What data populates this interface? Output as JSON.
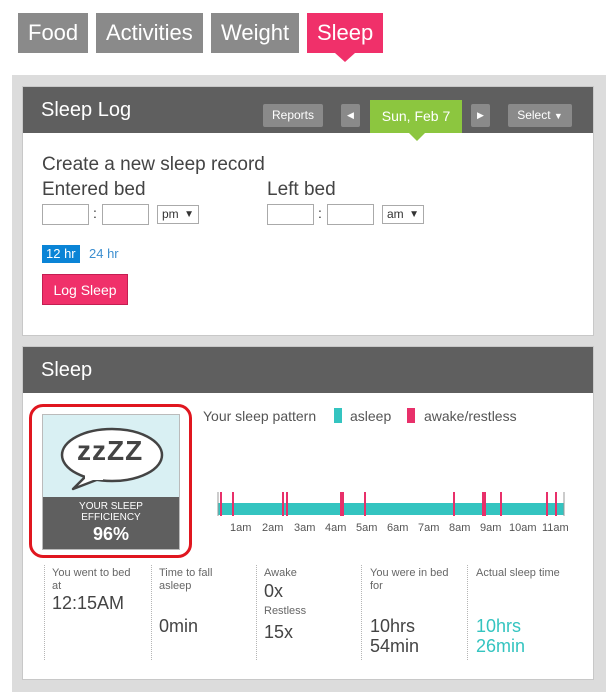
{
  "nav": {
    "tabs": [
      "Food",
      "Activities",
      "Weight",
      "Sleep"
    ],
    "active": "Sleep"
  },
  "sleep_log": {
    "title": "Sleep Log",
    "reports_label": "Reports",
    "prev_arrow": "◀",
    "next_arrow": "▶",
    "date": "Sun, Feb 7",
    "select_label": "Select",
    "create_title": "Create a new sleep record",
    "entered_bed_label": "Entered bed",
    "left_bed_label": "Left bed",
    "colon": ":",
    "entered_ampm": "pm",
    "left_ampm": "am",
    "hr12_label": "12 hr",
    "hr24_label": "24 hr",
    "log_button": "Log Sleep"
  },
  "sleep": {
    "title": "Sleep",
    "bubble_text": "zzZZ",
    "efficiency_label_1": "YOUR SLEEP",
    "efficiency_label_2": "EFFICIENCY",
    "efficiency_value": "96%",
    "pattern_label": "Your sleep pattern",
    "legend": [
      {
        "label": "asleep",
        "color": "#34c4c0"
      },
      {
        "label": "awake/restless",
        "color": "#e8306a"
      }
    ],
    "timeline_ticks": [
      "1am",
      "2am",
      "3am",
      "4am",
      "5am",
      "6am",
      "7am",
      "8am",
      "9am",
      "10am",
      "11am"
    ],
    "stats": {
      "went_to_bed_label_1": "You went to bed",
      "went_to_bed_label_2": "at",
      "went_to_bed_value": "12:15AM",
      "fall_asleep_label_1": "Time to fall",
      "fall_asleep_label_2": "asleep",
      "fall_asleep_value": "0min",
      "awake_label": "Awake",
      "awake_value": "0x",
      "restless_label": "Restless",
      "restless_value": "15x",
      "in_bed_label_1": "You were in bed",
      "in_bed_label_2": "for",
      "in_bed_value_1": "10hrs",
      "in_bed_value_2": "54min",
      "actual_label": "Actual sleep time",
      "actual_value_1": "10hrs",
      "actual_value_2": "26min"
    }
  }
}
